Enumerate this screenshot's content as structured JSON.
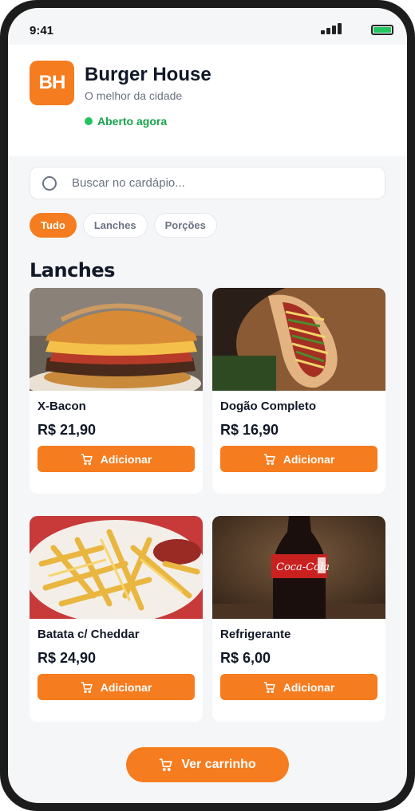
{
  "status_bar": {
    "time": "9:41"
  },
  "restaurant": {
    "logo_text": "BH",
    "name": "Burger House",
    "tagline": "O melhor da cidade",
    "status": "Aberto agora"
  },
  "search": {
    "placeholder": "Buscar no cardápio..."
  },
  "categories": [
    {
      "label": "Tudo",
      "active": true
    },
    {
      "label": "Lanches",
      "active": false
    },
    {
      "label": "Porções",
      "active": false
    }
  ],
  "section": {
    "title": "Lanches"
  },
  "products": [
    {
      "name": "X-Bacon",
      "price": "R$ 21,90",
      "button": "Adicionar",
      "image": "burger-photo"
    },
    {
      "name": "Dogão Completo",
      "price": "R$ 16,90",
      "button": "Adicionar",
      "image": "hotdog-photo"
    },
    {
      "name": "Batata c/ Cheddar",
      "price": "R$ 24,90",
      "button": "Adicionar",
      "image": "fries-photo"
    },
    {
      "name": "Refrigerante",
      "price": "R$ 6,00",
      "button": "Adicionar",
      "image": "soda-photo"
    }
  ],
  "cart_button": {
    "label": "Ver carrinho"
  },
  "colors": {
    "accent": "#f57c1f",
    "open": "#22c55e",
    "text": "#111827",
    "muted": "#6b7280"
  }
}
